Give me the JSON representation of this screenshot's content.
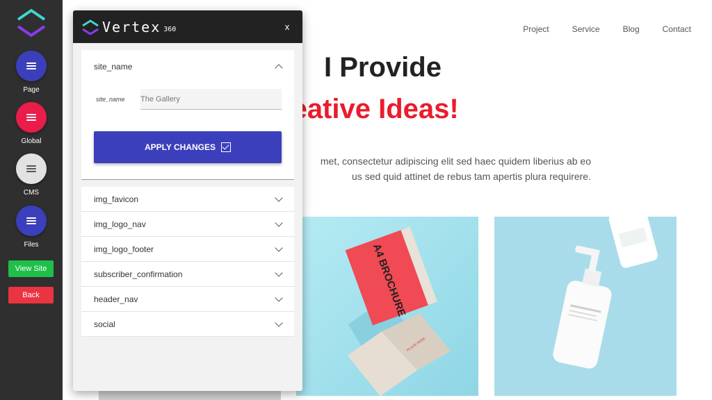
{
  "rail": {
    "buttons": [
      {
        "label": "Page",
        "color": "#3c3fbb"
      },
      {
        "label": "Global",
        "color": "#ea1c4a"
      },
      {
        "label": "CMS",
        "color": "#e2e2e2"
      },
      {
        "label": "Files",
        "color": "#3c3fbb"
      }
    ],
    "view_site": "View Site",
    "back": "Back"
  },
  "site": {
    "nav": [
      "Project",
      "Service",
      "Blog",
      "Contact"
    ],
    "hero_line1": "I Provide",
    "hero_line2": "reative Ideas!",
    "paragraph_line1": "met, consectetur adipiscing elit sed haec quidem liberius ab eo",
    "paragraph_line2": "us sed quid attinet de rebus tam apertis plura requirere.",
    "brochure_label": "A4 BROCHURE",
    "card_label": "PLACE HERE"
  },
  "panel": {
    "brand": "Vertex",
    "brand_sub": "360",
    "close": "x",
    "open_section": {
      "title": "site_name",
      "field_label": "site_name",
      "field_value": "The Gallery",
      "apply_label": "APPLY CHANGES"
    },
    "sections": [
      "img_favicon",
      "img_logo_nav",
      "img_logo_footer",
      "subscriber_confirmation",
      "header_nav",
      "social"
    ]
  },
  "colors": {
    "accent": "#3c3fbb",
    "danger": "#ea3441",
    "success": "#1fbf4a",
    "hero_red": "#ea1c2d"
  }
}
